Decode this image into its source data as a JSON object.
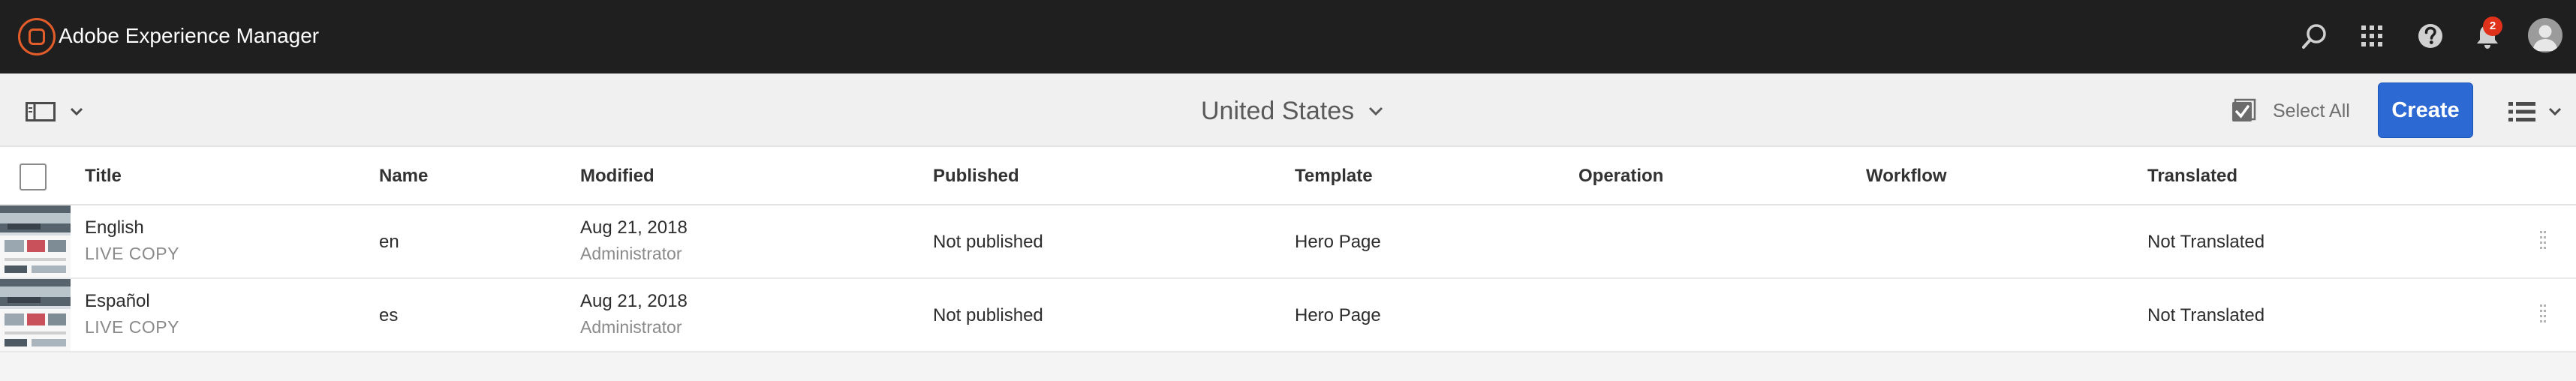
{
  "app": {
    "title": "Adobe Experience Manager",
    "logo_icon": "aem-logo-icon",
    "notification_count": "2",
    "colors": {
      "shell_bg": "#1f1f1f",
      "accent": "#2d69d2",
      "logo": "#e35d2b",
      "badge": "#e0311b"
    }
  },
  "shell_icons": [
    "search-icon",
    "apps-grid-icon",
    "help-icon",
    "bell-icon",
    "user-avatar"
  ],
  "actionbar": {
    "location": "United States",
    "select_all": "Select All",
    "create": "Create"
  },
  "table": {
    "columns": {
      "title": "Title",
      "name": "Name",
      "modified": "Modified",
      "published": "Published",
      "template": "Template",
      "operation": "Operation",
      "workflow": "Workflow",
      "translated": "Translated"
    },
    "rows": [
      {
        "title": "English",
        "subtitle": "LIVE COPY",
        "name": "en",
        "modified_date": "Aug 21, 2018",
        "modified_by": "Administrator",
        "published": "Not published",
        "template": "Hero Page",
        "operation": "",
        "workflow": "",
        "translated": "Not Translated"
      },
      {
        "title": "Español",
        "subtitle": "LIVE COPY",
        "name": "es",
        "modified_date": "Aug 21, 2018",
        "modified_by": "Administrator",
        "published": "Not published",
        "template": "Hero Page",
        "operation": "",
        "workflow": "",
        "translated": "Not Translated"
      }
    ]
  }
}
